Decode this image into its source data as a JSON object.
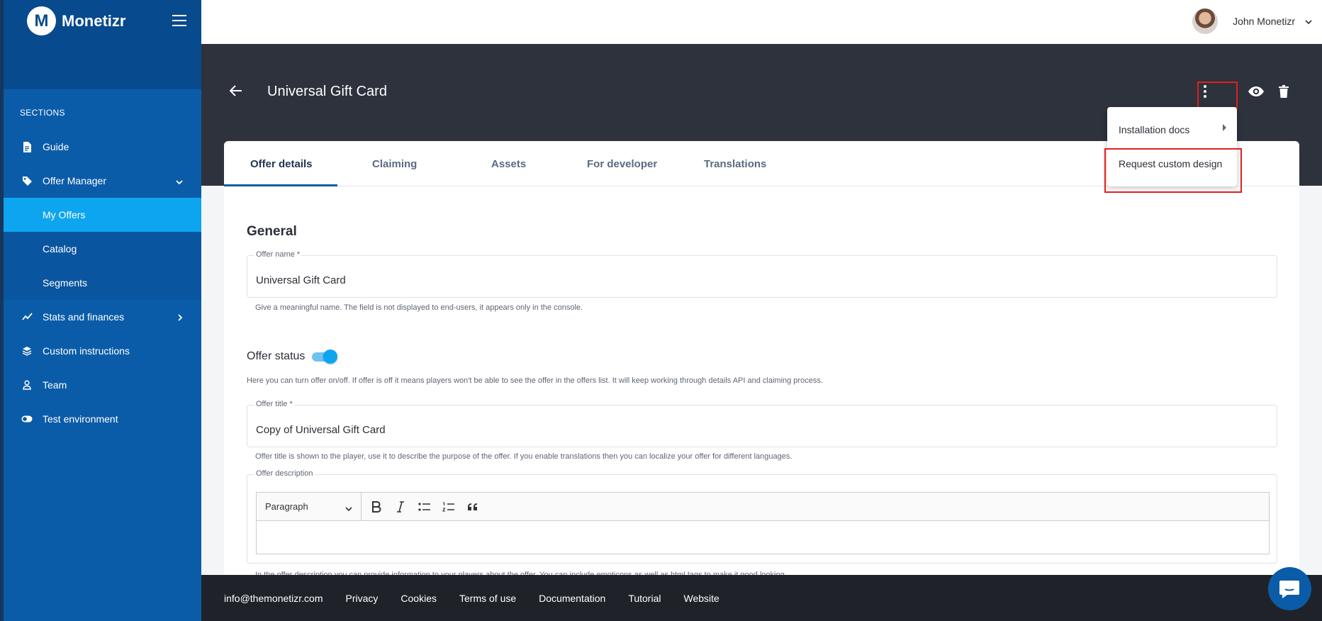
{
  "app": {
    "logo_letter": "M",
    "brand": "Monetizr"
  },
  "sidebar": {
    "section_label": "SECTIONS",
    "items": [
      {
        "label": "Guide",
        "icon": "document-icon"
      },
      {
        "label": "Offer Manager",
        "icon": "tag-icon"
      },
      {
        "label": "My Offers"
      },
      {
        "label": "Catalog"
      },
      {
        "label": "Segments"
      },
      {
        "label": "Stats and finances",
        "icon": "chart-line-icon"
      },
      {
        "label": "Custom instructions",
        "icon": "layers-icon"
      },
      {
        "label": "Team",
        "icon": "person-icon"
      },
      {
        "label": "Test environment",
        "icon": "toggle-icon"
      }
    ]
  },
  "topbar": {
    "username": "John Monetizr"
  },
  "header": {
    "title": "Universal Gift Card"
  },
  "tabs": [
    "Offer details",
    "Claiming",
    "Assets",
    "For developer",
    "Translations"
  ],
  "menu": {
    "item1": "Installation docs",
    "item2": "Request custom design"
  },
  "form": {
    "section_title": "General",
    "offer_name": {
      "label": "Offer name *",
      "value": "Universal Gift Card",
      "hint": "Give a meaningful name. The field is not displayed to end-users, it appears only in the console."
    },
    "offer_status": {
      "label": "Offer status",
      "enabled": true,
      "hint": "Here you can turn offer on/off. If offer is off it means players won't be able to see the offer in the offers list. It will keep working through details API and claiming process."
    },
    "offer_title": {
      "label": "Offer title *",
      "value": "Copy of Universal Gift Card",
      "hint": "Offer title is shown to the player, use it to describe the purpose of the offer. If you enable translations then you can localize your offer for different languages."
    },
    "offer_description": {
      "label": "Offer description",
      "format": "Paragraph",
      "hint": "In the offer description you can provide information to your players about the offer. You can include emoticons as well as html tags to make it good looking."
    }
  },
  "footer": [
    "info@themonetizr.com",
    "Privacy",
    "Cookies",
    "Terms of use",
    "Documentation",
    "Tutorial",
    "Website"
  ],
  "colors": {
    "sidebar": "#0b5ca8",
    "active": "#0ea5f0",
    "header": "#2d323c",
    "footer": "#1f2329",
    "highlight": "#e02020"
  }
}
